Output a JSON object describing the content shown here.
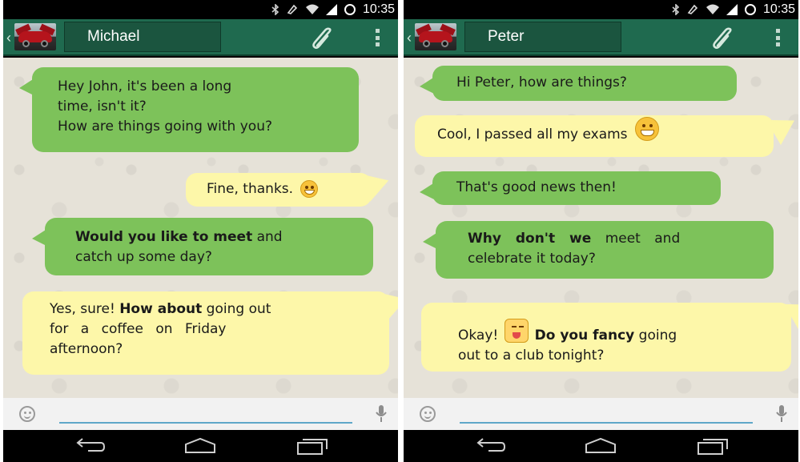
{
  "status_bar": {
    "time": "10:35"
  },
  "colors": {
    "action_bar": "#1f6a4f",
    "bubble_green": "#7dc25a",
    "bubble_yellow": "#fdf7a9",
    "input_underline": "#5fa7c9"
  },
  "icons": [
    "back-arrow-icon",
    "avatar",
    "paperclip-icon",
    "overflow-menu-icon",
    "smiley-icon",
    "microphone-icon",
    "nav-back-icon",
    "nav-home-icon",
    "nav-recent-icon",
    "grin-emoji-icon",
    "wink-tongue-emoji-icon"
  ],
  "left_chat": {
    "contact_name": "Michael",
    "messages": [
      {
        "lines": [
          "Hey John, it's been a long",
          "time, isn't it?",
          "How are things going with you?"
        ]
      },
      {
        "text": "Fine, thanks."
      },
      {
        "bold": "Would you like to meet",
        "rest": " and",
        "line2": "catch up some day?"
      },
      {
        "pre": "Yes, sure! ",
        "bold": "How about",
        "post": " going out",
        "line2": "for a coffee on Friday",
        "line3": "afternoon?"
      }
    ]
  },
  "right_chat": {
    "contact_name": "Peter",
    "messages": [
      {
        "text": "Hi Peter, how are things?"
      },
      {
        "text": "Cool, I passed all my exams"
      },
      {
        "text": "That's good news then!"
      },
      {
        "bold": "Why don't we",
        "rest": " meet and",
        "line2": "celebrate it today?"
      },
      {
        "pre": "Okay! ",
        "bold": "Do you fancy",
        "post": " going",
        "line2": "out to a club tonight?"
      }
    ]
  }
}
